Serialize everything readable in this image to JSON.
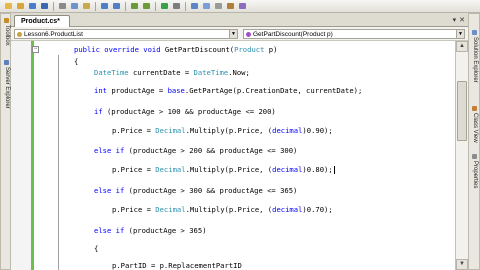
{
  "toolbar": {
    "icons": [
      "new-project-icon",
      "open-icon",
      "save-icon",
      "save-all-icon",
      "cut-icon",
      "copy-icon",
      "paste-icon",
      "undo-icon",
      "redo-icon",
      "navigate-back-icon",
      "navigate-forward-icon",
      "start-debug-icon",
      "solution-config-icon",
      "find-icon",
      "solution-explorer-icon",
      "properties-icon",
      "toolbox-icon",
      "object-browser-icon"
    ]
  },
  "dock_left": {
    "toolbox_label": "Toolbox",
    "server_explorer_label": "Server Explorer"
  },
  "dock_right": {
    "solution_explorer_label": "Solution Explorer",
    "class_view_label": "Class View",
    "properties_label": "Properties"
  },
  "doc_tab": {
    "title": "Product.cs*"
  },
  "navbar": {
    "type_value": "Lesson6.ProductList",
    "member_value": "GetPartDiscount(Product p)"
  },
  "code_lines": [
    {
      "id": "l1",
      "tokens": [
        [
          "kw",
          "public "
        ],
        [
          "kw",
          "override "
        ],
        [
          "kw",
          "void "
        ],
        [
          "",
          "GetPartDiscount("
        ],
        [
          "ty",
          "Product"
        ],
        [
          "",
          " p)"
        ]
      ]
    },
    {
      "id": "l2",
      "tokens": [
        [
          "",
          "{"
        ]
      ]
    },
    {
      "id": "l3",
      "tokens": [
        [
          "ty",
          "DateTime"
        ],
        [
          "",
          " currentDate = "
        ],
        [
          "ty",
          "DateTime"
        ],
        [
          "",
          ".Now;"
        ]
      ]
    },
    {
      "id": "l4",
      "tokens": [
        [
          "kw",
          "int "
        ],
        [
          "",
          "productAge = "
        ],
        [
          "kw",
          "base"
        ],
        [
          "",
          ".GetPartAge(p.CreationDate, currentDate);"
        ]
      ]
    },
    {
      "id": "l5",
      "tokens": [
        [
          "kw",
          "if "
        ],
        [
          "",
          "(productAge > 100 && productAge <= 200)"
        ]
      ]
    },
    {
      "id": "l6",
      "tokens": [
        [
          "",
          "p.Price = "
        ],
        [
          "ty",
          "Decimal"
        ],
        [
          "",
          ".Multiply(p.Price, ("
        ],
        [
          "kw",
          "decimal"
        ],
        [
          "",
          ")0.90);"
        ]
      ]
    },
    {
      "id": "l7",
      "tokens": [
        [
          "kw",
          "else "
        ],
        [
          "kw",
          "if "
        ],
        [
          "",
          "(productAge > 200 && productAge <= 300)"
        ]
      ]
    },
    {
      "id": "l8",
      "tokens": [
        [
          "",
          "p.Price = "
        ],
        [
          "ty",
          "Decimal"
        ],
        [
          "",
          ".Multiply(p.Price, ("
        ],
        [
          "kw",
          "decimal"
        ],
        [
          "",
          ")0.80);"
        ]
      ]
    },
    {
      "id": "l9",
      "tokens": [
        [
          "kw",
          "else "
        ],
        [
          "kw",
          "if "
        ],
        [
          "",
          "(productAge > 300 && productAge <= 365)"
        ]
      ]
    },
    {
      "id": "l10",
      "tokens": [
        [
          "",
          "p.Price = "
        ],
        [
          "ty",
          "Decimal"
        ],
        [
          "",
          ".Multiply(p.Price, ("
        ],
        [
          "kw",
          "decimal"
        ],
        [
          "",
          ")0.70);"
        ]
      ]
    },
    {
      "id": "l11",
      "tokens": [
        [
          "kw",
          "else "
        ],
        [
          "kw",
          "if "
        ],
        [
          "",
          "(productAge > 365)"
        ]
      ]
    },
    {
      "id": "l12",
      "tokens": [
        [
          "",
          "{"
        ]
      ]
    },
    {
      "id": "l13",
      "tokens": [
        [
          "",
          "p.PartID = p.ReplacementPartID"
        ]
      ]
    }
  ],
  "colors": {
    "keyword": "#0000ff",
    "type": "#2b91af",
    "change_bar": "#6cbf4d"
  }
}
